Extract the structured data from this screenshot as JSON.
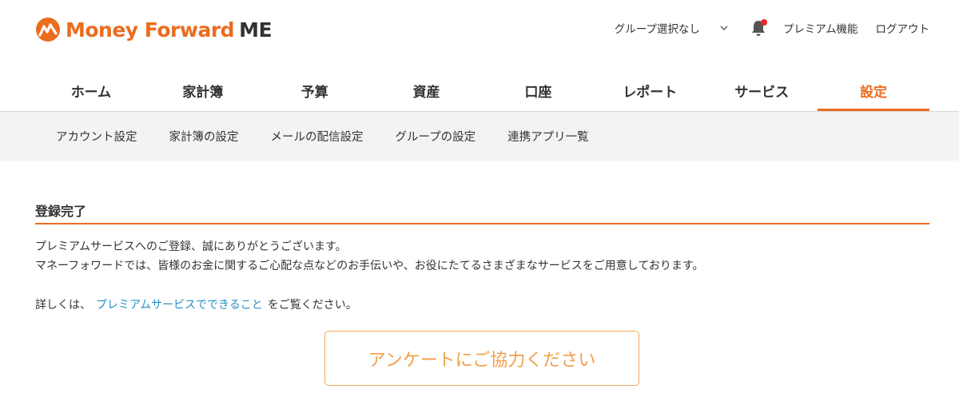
{
  "logo": {
    "brand": "Money Forward",
    "suffix": "ME"
  },
  "header": {
    "group_select": "グループ選択なし",
    "premium": "プレミアム機能",
    "logout": "ログアウト",
    "notification_icon": "bell-icon",
    "notification_dot_color": "#e8262b"
  },
  "main_nav": {
    "tabs": [
      {
        "label": "ホーム"
      },
      {
        "label": "家計簿"
      },
      {
        "label": "予算"
      },
      {
        "label": "資産"
      },
      {
        "label": "口座"
      },
      {
        "label": "レポート"
      },
      {
        "label": "サービス"
      },
      {
        "label": "設定",
        "active": true
      }
    ]
  },
  "sub_nav": {
    "items": [
      {
        "label": "アカウント設定"
      },
      {
        "label": "家計簿の設定"
      },
      {
        "label": "メールの配信設定"
      },
      {
        "label": "グループの設定"
      },
      {
        "label": "連携アプリ一覧"
      }
    ]
  },
  "content": {
    "title": "登録完了",
    "line1": "プレミアムサービスへのご登録、誠にありがとうございます。",
    "line2": "マネーフォワードでは、皆様のお金に関するご心配な点などのお手伝いや、お役にたてるさまざまなサービスをご用意しております。",
    "details_prefix": "詳しくは、",
    "details_link": "プレミアムサービスでできること",
    "details_suffix": "をご覧ください。",
    "survey_button": "アンケートにご協力ください"
  },
  "colors": {
    "accent": "#ec6c1e",
    "link": "#2a8fc1",
    "subnav_bg": "#f3f3f3"
  }
}
